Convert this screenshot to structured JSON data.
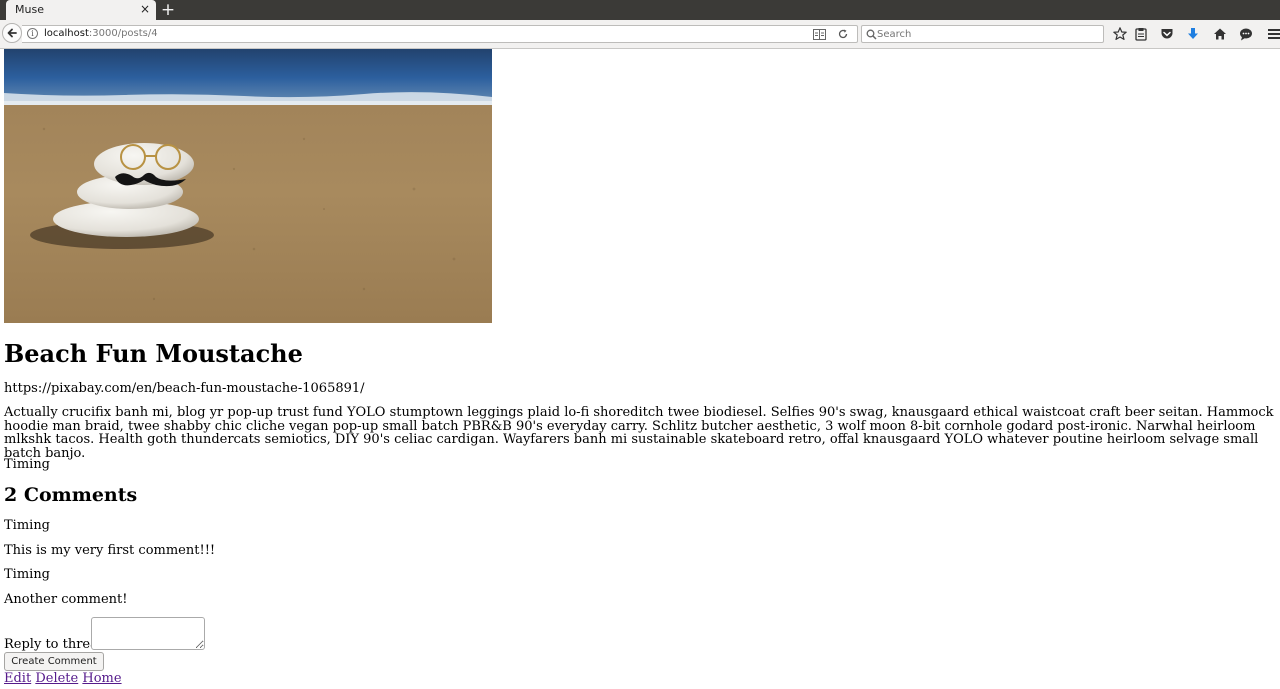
{
  "browser": {
    "tab_title": "Muse",
    "tab_close": "×",
    "new_tab": "+",
    "url_host": "localhost",
    "url_rest": ":3000/posts/4",
    "search_placeholder": "Search"
  },
  "post": {
    "image_alt": "Stacked pebbles with glasses and a moustache on a sandy beach",
    "title": "Beach Fun Moustache",
    "source": "https://pixabay.com/en/beach-fun-moustache-1065891/",
    "body": "Actually crucifix banh mi, blog yr pop-up trust fund YOLO stumptown leggings plaid lo-fi shoreditch twee biodiesel. Selfies 90's swag, knausgaard ethical waistcoat craft beer seitan. Hammock hoodie man braid, twee shabby chic cliche vegan pop-up small batch PBR&B 90's everyday carry. Schlitz butcher aesthetic, 3 wolf moon 8-bit cornhole godard post-ironic. Narwhal heirloom mlkshk tacos. Health goth thundercats semiotics, DIY 90's celiac cardigan. Wayfarers banh mi sustainable skateboard retro, offal knausgaard YOLO whatever poutine heirloom selvage small batch banjo.",
    "timing": "Timing"
  },
  "comments": {
    "heading": "2 Comments",
    "items": [
      {
        "timing": "Timing",
        "text": "This is my very first comment!!!"
      },
      {
        "timing": "Timing",
        "text": "Another comment!"
      }
    ],
    "reply_label": "Reply to thread",
    "submit_label": "Create Comment"
  },
  "links": {
    "edit": "Edit",
    "delete": "Delete",
    "home": "Home"
  }
}
